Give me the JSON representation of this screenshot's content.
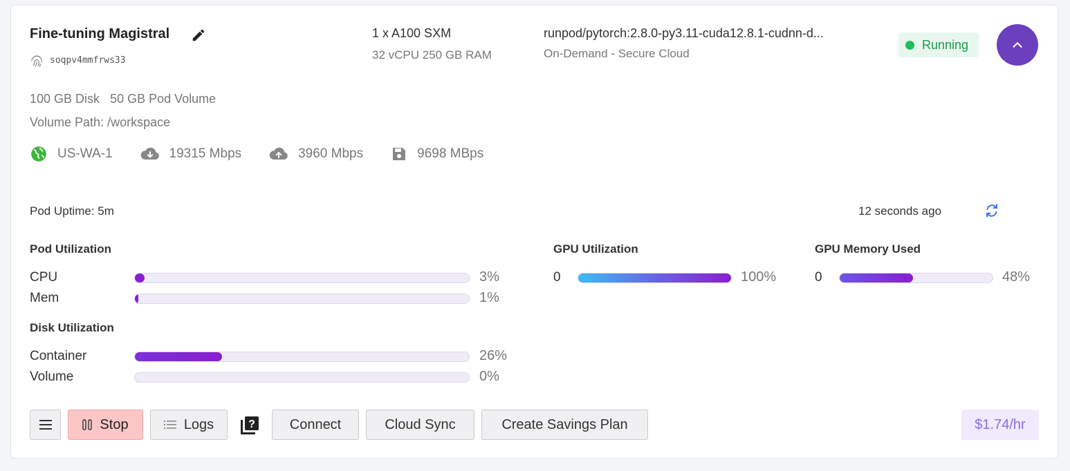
{
  "pod": {
    "name": "Fine-tuning Magistral",
    "id": "soqpv4mmfrws33",
    "gpu": "1 x A100 SXM",
    "specs": "32 vCPU 250 GB RAM",
    "image": "runpod/pytorch:2.8.0-py3.11-cuda12.8.1-cudnn-d...",
    "cloud": "On-Demand - Secure Cloud",
    "status": "Running",
    "status_color": "#1fbe5a",
    "disk": "100 GB Disk",
    "volume": "50 GB Pod Volume",
    "volume_path": "Volume Path: /workspace"
  },
  "network": {
    "region": "US-WA-1",
    "download": "19315 Mbps",
    "upload": "3960 Mbps",
    "disk_speed": "9698 MBps",
    "icons": [
      "globe-icon",
      "cloud-download-icon",
      "cloud-upload-icon",
      "floppy-disk-icon"
    ]
  },
  "uptime": "Pod Uptime: 5m",
  "updated": "12 seconds ago",
  "pod_utilization": {
    "title": "Pod Utilization",
    "cpu": {
      "label": "CPU",
      "value": 3,
      "text": "3%"
    },
    "mem": {
      "label": "Mem",
      "value": 1,
      "text": "1%"
    }
  },
  "disk_utilization": {
    "title": "Disk Utilization",
    "container": {
      "label": "Container",
      "value": 26,
      "text": "26%"
    },
    "volume": {
      "label": "Volume",
      "value": 0,
      "text": "0%"
    }
  },
  "gpu_utilization": {
    "title": "GPU Utilization",
    "index": "0",
    "value": 100,
    "text": "100%"
  },
  "gpu_memory": {
    "title": "GPU Memory Used",
    "index": "0",
    "value": 48,
    "text": "48%"
  },
  "actions": {
    "stop": "Stop",
    "logs": "Logs",
    "connect": "Connect",
    "cloud_sync": "Cloud Sync",
    "savings_plan": "Create Savings Plan"
  },
  "price": "$1.74/hr",
  "colors": {
    "accent": "#6c3fbf",
    "bar": "#8a1ed0",
    "stop_bg": "#fcc6c6",
    "price_bg": "#efeafc"
  }
}
